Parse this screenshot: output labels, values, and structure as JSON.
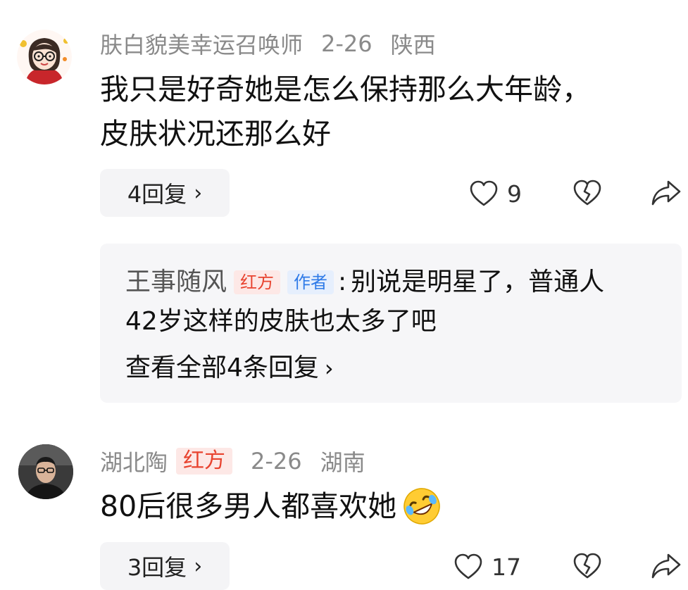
{
  "comments": [
    {
      "username": "肤白貌美幸运召唤师",
      "badge": "",
      "date": "2-26",
      "location": "陕西",
      "text_lines": [
        "我只是好奇她是怎么保持那么大年龄，",
        "皮肤状况还那么好"
      ],
      "reply_button": "4回复",
      "like_count": "9",
      "icons": [
        "heart-icon",
        "broken-heart-icon",
        "share-icon"
      ],
      "replies_preview": {
        "author": "王事随风",
        "badge_red": "红方",
        "badge_author": "作者",
        "separator": ":",
        "text_lines": [
          "别说是明星了，普通人",
          "42岁这样的皮肤也太多了吧"
        ],
        "view_all": "查看全部4条回复"
      }
    },
    {
      "username": "湖北陶",
      "badge": "红方",
      "date": "2-26",
      "location": "湖南",
      "text_lines": [
        "80后很多男人都喜欢她"
      ],
      "emoji": "rolling-laughing-emoji",
      "reply_button": "3回复",
      "like_count": "17",
      "icons": [
        "heart-icon",
        "broken-heart-icon",
        "share-icon"
      ]
    }
  ],
  "colors": {
    "meta_gray": "#8a8a8a",
    "badge_red": "#e8432f",
    "badge_blue": "#2f7be8",
    "panel_bg": "#f6f6f8"
  }
}
